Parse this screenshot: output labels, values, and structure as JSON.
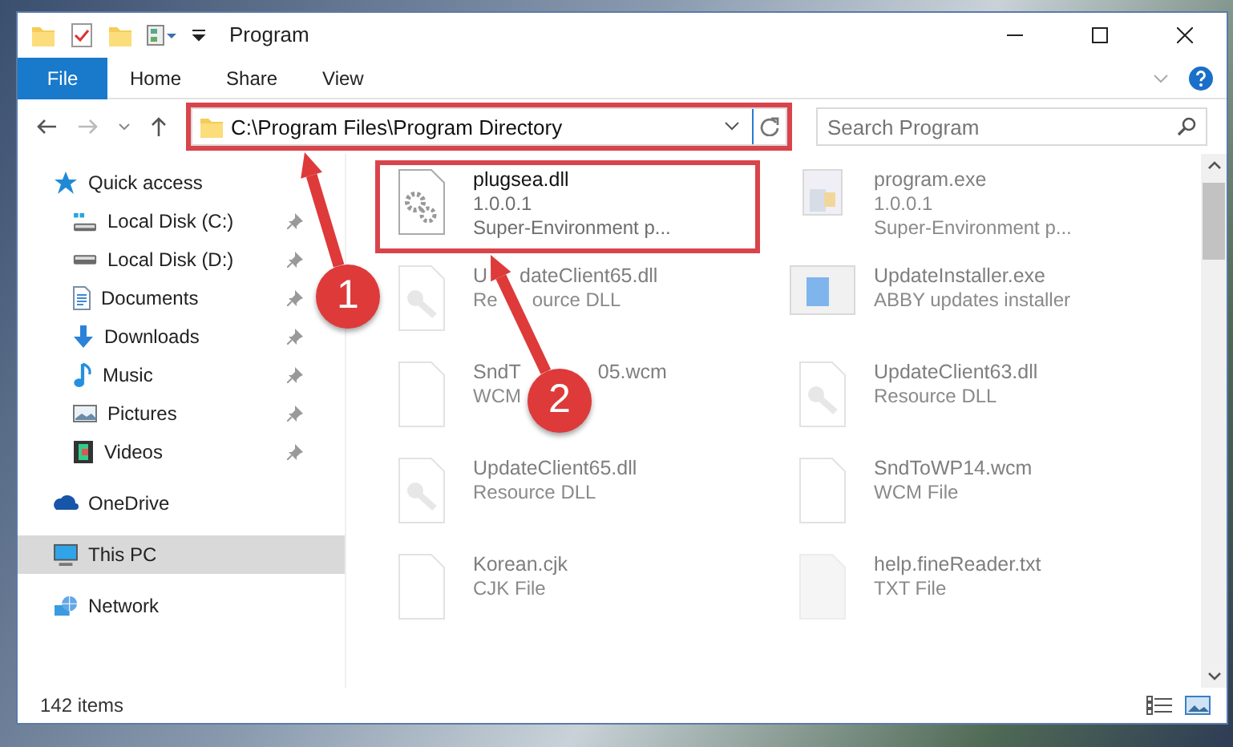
{
  "window": {
    "title": "Program"
  },
  "ribbon_tabs": [
    {
      "label": "File",
      "selected": true
    },
    {
      "label": "Home",
      "selected": false
    },
    {
      "label": "Share",
      "selected": false
    },
    {
      "label": "View",
      "selected": false
    }
  ],
  "address_bar": {
    "path": "C:\\Program Files\\Program Directory",
    "highlighted": true
  },
  "search": {
    "placeholder": "Search Program"
  },
  "sidebar": {
    "items": [
      {
        "label": "Quick access",
        "selected": false,
        "children": [
          {
            "label": "Local Disk (C:)",
            "pinned": true,
            "selected": false
          },
          {
            "label": "Local Disk (D:)",
            "pinned": true,
            "selected": false
          },
          {
            "label": "Documents",
            "pinned": true,
            "selected": false
          },
          {
            "label": "Downloads",
            "pinned": true,
            "selected": false
          },
          {
            "label": "Music",
            "pinned": true,
            "selected": false
          },
          {
            "label": "Pictures",
            "pinned": true,
            "selected": false
          },
          {
            "label": "Videos",
            "pinned": true,
            "selected": false
          }
        ]
      },
      {
        "label": "OneDrive",
        "selected": false
      },
      {
        "label": "This PC",
        "selected": true
      },
      {
        "label": "Network",
        "selected": false
      }
    ]
  },
  "files": [
    {
      "name": [
        "plugsea.dll"
      ],
      "details": [
        [
          "1.0.0.1"
        ],
        [
          "Super-Environment p..."
        ]
      ],
      "kind": "gear",
      "highlighted": true
    },
    {
      "name": [
        "program.exe"
      ],
      "details": [
        [
          "1.0.0.1"
        ],
        [
          "Super-Environment p..."
        ]
      ],
      "kind": "exe",
      "highlighted": false
    },
    {
      "name": [
        "U",
        "dateClient65.dll"
      ],
      "details": [
        [
          "Re",
          "ource DLL"
        ]
      ],
      "kind": "dll",
      "highlighted": false
    },
    {
      "name": [
        "UpdateInstaller.exe"
      ],
      "details": [
        [
          "ABBY updates installer"
        ]
      ],
      "kind": "installer",
      "highlighted": false
    },
    {
      "name": [
        "SndT",
        "05.wcm"
      ],
      "details": [
        [
          "WCM"
        ]
      ],
      "kind": "blank",
      "highlighted": false
    },
    {
      "name": [
        "UpdateClient63.dll"
      ],
      "details": [
        [
          "Resource DLL"
        ]
      ],
      "kind": "dll",
      "highlighted": false
    },
    {
      "name": [
        "UpdateClient65.dll"
      ],
      "details": [
        [
          "Resource DLL"
        ]
      ],
      "kind": "dll",
      "highlighted": false
    },
    {
      "name": [
        "SndToWP14.wcm"
      ],
      "details": [
        [
          "WCM File"
        ]
      ],
      "kind": "blank",
      "highlighted": false
    },
    {
      "name": [
        "Korean.cjk"
      ],
      "details": [
        [
          "CJK File"
        ]
      ],
      "kind": "blank",
      "highlighted": false
    },
    {
      "name": [
        "help.fineReader.txt"
      ],
      "details": [
        [
          "TXT File"
        ]
      ],
      "kind": "txt",
      "highlighted": false
    }
  ],
  "status_bar": {
    "item_count": "142 items"
  },
  "annotations": [
    {
      "number": "1"
    },
    {
      "number": "2"
    }
  ]
}
